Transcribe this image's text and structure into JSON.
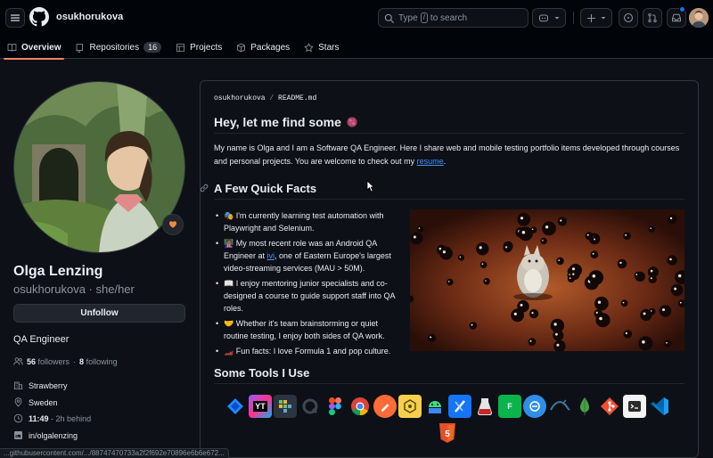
{
  "header": {
    "owner": "osukhorukova",
    "search": {
      "prefix": "Type",
      "key": "/",
      "suffix": "to search"
    }
  },
  "tabs": [
    {
      "label": "Overview",
      "icon": "book-icon"
    },
    {
      "label": "Repositories",
      "icon": "repo-icon",
      "count": "16"
    },
    {
      "label": "Projects",
      "icon": "table-icon"
    },
    {
      "label": "Packages",
      "icon": "package-icon"
    },
    {
      "label": "Stars",
      "icon": "star-icon"
    }
  ],
  "profile": {
    "name": "Olga Lenzing",
    "login": "osukhorukova · she/her",
    "unfollow_label": "Unfollow",
    "bio": "QA Engineer",
    "followers": "56",
    "followers_label": "followers",
    "dot": "·",
    "following": "8",
    "following_label": "following",
    "company": "Strawberry",
    "location": "Sweden",
    "time": "11:49",
    "time_note": "- 2h behind",
    "linkedin": "in/olgalenzing"
  },
  "readme": {
    "crumb_owner": "osukhorukova",
    "crumb_sep": "/",
    "crumb_file": "README.md",
    "title": "Hey, let me find some",
    "intro": "My name is Olga and I am a Software QA Engineer. Here I share web and mobile testing portfolio items developed through courses and personal projects. You are welcome to check out my",
    "resume_link": "resume",
    "intro_end": ".",
    "facts_title": "A Few Quick Facts",
    "facts": [
      {
        "text": "🎭 I'm currently learning test automation with Playwright and Selenium."
      },
      {
        "pre": "👩🏽‍🏫 My most recent role was an Android QA Engineer at ",
        "link": "ivi",
        "post": ", one of Eastern Europe's largest video-streaming services (MAU > 50M)."
      },
      {
        "text": "📖 I enjoy mentoring junior specialists and co-designed a course to guide support staff into QA roles."
      },
      {
        "text": "🤝 Whether it's team brainstorming or quiet routine testing, I enjoy both sides of QA work."
      },
      {
        "text": "🏎️ Fun facts: I love Formula 1 and pop culture."
      }
    ],
    "tools_title": "Some Tools I Use",
    "tools": [
      "jira-icon",
      "youtrack-icon",
      "testrail-icon",
      "qase-icon",
      "figma-icon",
      "chrome-dev-icon",
      "postman-icon",
      "charles-icon",
      "android-studio-icon",
      "xcode-icon",
      "jmeter-icon",
      "fiddler-icon",
      "proxyman-icon",
      "mysql-icon",
      "mongodb-icon",
      "git-icon",
      "terminal-icon",
      "vscode-icon",
      "html5-icon"
    ],
    "tool_labels": {
      "youtrack": "YT",
      "fiddler": "F",
      "html5": "5"
    }
  },
  "status_url": "...githubusercontent.com/.../88747470733a2f2f692e70896e6b6e672...",
  "colors": {
    "accent": "#f78166",
    "link": "#4493f8",
    "bg": "#0d1117",
    "header_bg": "#010409"
  }
}
